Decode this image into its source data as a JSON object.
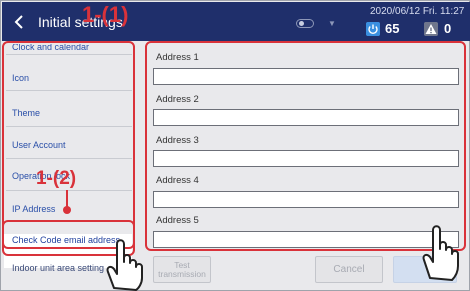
{
  "header": {
    "title": "Initial settings",
    "datetime": "2020/06/12 Fri. 11:27",
    "power_count": "65",
    "alert_count": "0",
    "colors": {
      "bar": "#1f2f6b",
      "power": "#3a8fe0",
      "alert": "#6f768c"
    }
  },
  "sidebar": {
    "items": [
      {
        "label": "Clock and calendar"
      },
      {
        "label": "Icon"
      },
      {
        "label": "Theme"
      },
      {
        "label": "User Account"
      },
      {
        "label": "Operation lock"
      },
      {
        "label": "IP Address"
      },
      {
        "label": "Check Code email address",
        "selected": true
      },
      {
        "label": "Indoor unit area setting"
      }
    ]
  },
  "main": {
    "addresses": [
      {
        "label": "Address 1",
        "value": ""
      },
      {
        "label": "Address 2",
        "value": ""
      },
      {
        "label": "Address 3",
        "value": ""
      },
      {
        "label": "Address 4",
        "value": ""
      },
      {
        "label": "Address 5",
        "value": ""
      }
    ]
  },
  "footer": {
    "test_line1": "Test",
    "test_line2": "transmission",
    "cancel": "Cancel",
    "ok": ""
  },
  "annotations": {
    "callout_1": "1-(1)",
    "callout_2": "1-(2)",
    "color": "#d9323a"
  }
}
